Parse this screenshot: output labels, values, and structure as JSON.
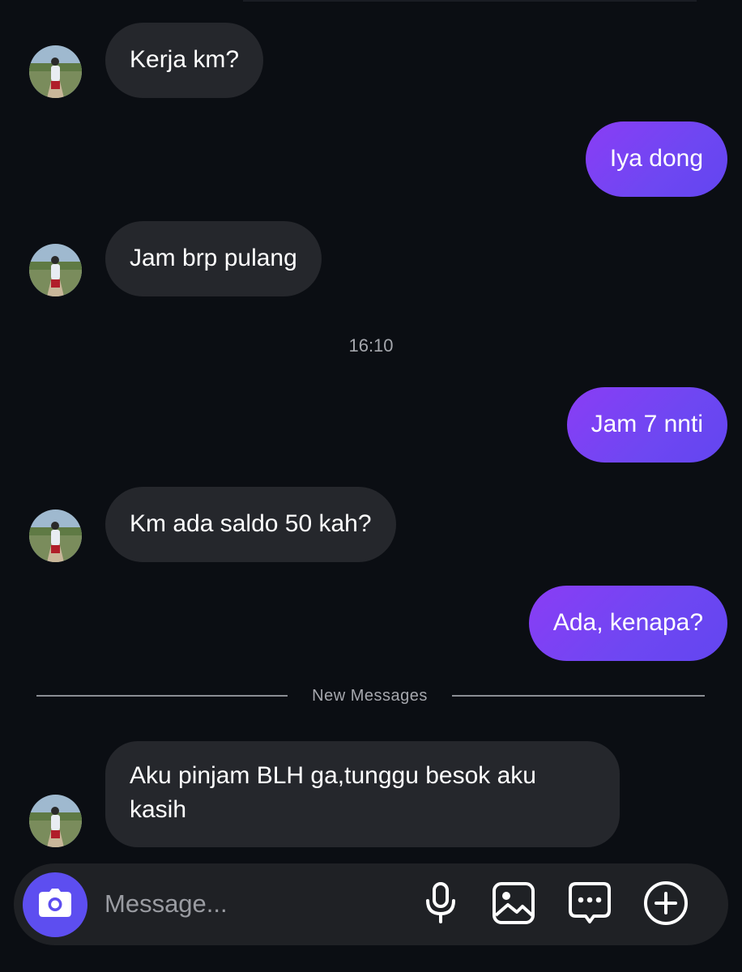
{
  "timestamp": "16:10",
  "divider_label": "New Messages",
  "messages": [
    {
      "direction": "incoming",
      "text": "Kerja km?"
    },
    {
      "direction": "outgoing",
      "text": "Iya dong"
    },
    {
      "direction": "incoming",
      "text": "Jam brp pulang"
    },
    {
      "direction": "outgoing",
      "text": "Jam 7 nnti"
    },
    {
      "direction": "incoming",
      "text": "Km ada saldo 50 kah?"
    },
    {
      "direction": "outgoing",
      "text": "Ada, kenapa?"
    },
    {
      "direction": "incoming",
      "text": "Aku pinjam BLH ga,tunggu besok aku kasih"
    }
  ],
  "composer": {
    "placeholder": "Message...",
    "icons": [
      "camera-icon",
      "microphone-icon",
      "image-icon",
      "sticker-chat-icon",
      "plus-circle-icon"
    ]
  },
  "colors": {
    "background": "#0b0e13",
    "incoming_bubble": "#25272c",
    "outgoing_bubble": "#7042f3",
    "camera_button": "#5d4ef0"
  }
}
